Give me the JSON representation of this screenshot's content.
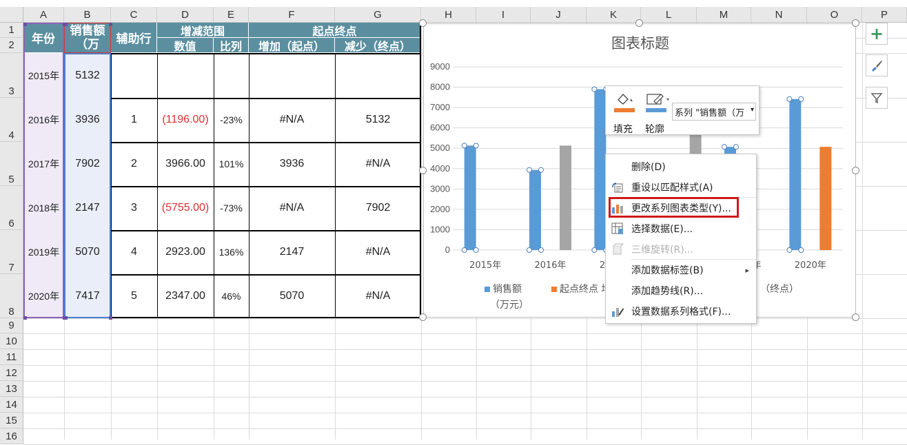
{
  "columns": [
    "A",
    "B",
    "C",
    "D",
    "E",
    "F",
    "G",
    "H",
    "I",
    "J",
    "K",
    "L",
    "M",
    "N",
    "O",
    "P"
  ],
  "rows": [
    "1",
    "2",
    "3",
    "4",
    "5",
    "6",
    "7",
    "8",
    "9",
    "10",
    "11",
    "12",
    "13",
    "14",
    "15",
    "16"
  ],
  "table": {
    "h_year": "年份",
    "h_sales": "销售额（万",
    "h_helper": "辅助行",
    "h_range": "增减范围",
    "h_value": "数值",
    "h_ratio": "比列",
    "h_endpoints": "起点终点",
    "h_increase": "增加（起点）",
    "h_decrease": "减少（终点）",
    "data": [
      {
        "year": "2015年",
        "sales": "5132",
        "helper": "",
        "value": "",
        "ratio": "",
        "inc": "",
        "dec": ""
      },
      {
        "year": "2016年",
        "sales": "3936",
        "helper": "1",
        "value": "(1196.00)",
        "ratio": "-23%",
        "inc": "#N/A",
        "dec": "5132"
      },
      {
        "year": "2017年",
        "sales": "7902",
        "helper": "2",
        "value": "3966.00",
        "ratio": "101%",
        "inc": "3936",
        "dec": "#N/A"
      },
      {
        "year": "2018年",
        "sales": "2147",
        "helper": "3",
        "value": "(5755.00)",
        "ratio": "-73%",
        "inc": "#N/A",
        "dec": "7902"
      },
      {
        "year": "2019年",
        "sales": "5070",
        "helper": "4",
        "value": "2923.00",
        "ratio": "136%",
        "inc": "2147",
        "dec": "#N/A"
      },
      {
        "year": "2020年",
        "sales": "7417",
        "helper": "5",
        "value": "2347.00",
        "ratio": "46%",
        "inc": "5070",
        "dec": "#N/A"
      }
    ]
  },
  "chart_data": {
    "type": "bar",
    "title": "图表标题",
    "categories": [
      "2015年",
      "2016年",
      "2017年",
      "2018年",
      "2019年",
      "2020年"
    ],
    "ylim": [
      0,
      9000
    ],
    "yticks": [
      "0",
      "1000",
      "2000",
      "3000",
      "4000",
      "5000",
      "6000",
      "7000",
      "8000",
      "9000"
    ],
    "series": [
      {
        "name": "销售额（万元）",
        "color": "#5b9bd5",
        "values": [
          5132,
          3936,
          7902,
          2147,
          5070,
          7417
        ]
      },
      {
        "name": "起点终点 增加（起点）",
        "color": "#a5a5a5",
        "values": [
          null,
          5132,
          null,
          7902,
          null,
          null
        ]
      },
      {
        "name": "减少（终点）",
        "color": "#ed7d31",
        "values": [
          null,
          null,
          null,
          null,
          null,
          5070
        ]
      }
    ],
    "legend": {
      "sales_line1": "销售额",
      "sales_line2": "（万元）",
      "endpoints": "起点终点 增",
      "decrease": "（终点）"
    }
  },
  "format_toolbar": {
    "fill_label": "填充",
    "outline_label": "轮廓",
    "series_select": "系列 \"销售额（万",
    "fill_color": "#ed7d31",
    "outline_color": "#5b9bd5"
  },
  "context_menu": {
    "items": [
      {
        "label": "删除(D)",
        "icon": "",
        "enabled": true
      },
      {
        "label": "重设以匹配样式(A)",
        "icon": "reset-style-icon",
        "enabled": true
      },
      {
        "label": "更改系列图表类型(Y)...",
        "icon": "chart-type-icon",
        "enabled": true,
        "highlighted": true
      },
      {
        "label": "选择数据(E)...",
        "icon": "select-data-icon",
        "enabled": true
      },
      {
        "label": "三维旋转(R)...",
        "icon": "rotate-3d-icon",
        "enabled": false
      },
      {
        "label": "添加数据标签(B)",
        "icon": "",
        "enabled": true,
        "submenu": true
      },
      {
        "label": "添加趋势线(R)...",
        "icon": "",
        "enabled": true
      },
      {
        "label": "设置数据系列格式(F)...",
        "icon": "format-series-icon",
        "enabled": true
      }
    ]
  },
  "side_buttons": {
    "add": "chart-elements-icon",
    "style": "chart-styles-icon",
    "filter": "chart-filter-icon"
  }
}
